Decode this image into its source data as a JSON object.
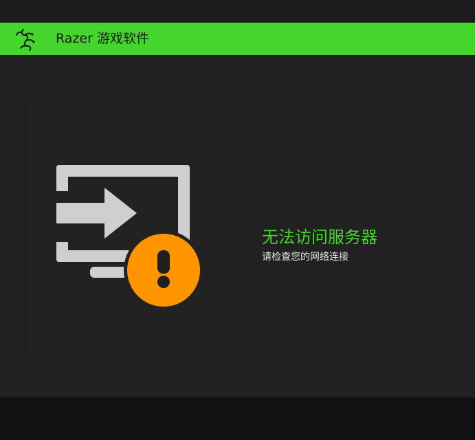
{
  "header": {
    "title": "Razer 游戏软件",
    "logo_icon": "razer-snake-logo-icon",
    "background_color": "#44d62c"
  },
  "illustration": {
    "icon": "server-connection-error-icon",
    "badge_icon": "exclamation-icon",
    "badge_color": "#ff9600"
  },
  "message": {
    "title": "无法访问服务器",
    "subtitle": "请检查您的网络连接",
    "title_color": "#44d62c"
  }
}
